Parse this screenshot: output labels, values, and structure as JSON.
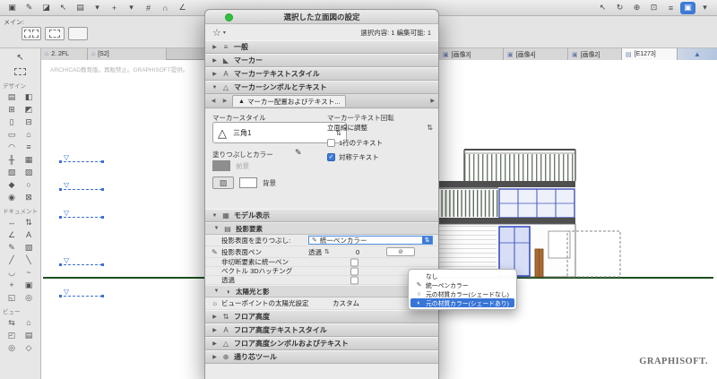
{
  "window": {
    "dialog_title": "選択した立面図の設定",
    "selection_info": "選択内容: 1 編集可能: 1",
    "main_label": "メイン:",
    "watermark": "ARCHICAD教育版。再販禁止。GRAPHISOFT提供。",
    "logo_text": "GRAPHISOFT."
  },
  "colors": {
    "accent": "#3f7ad6",
    "menu_highlight": "#3875d7",
    "selection_blue": "#3b6fd6",
    "ground_green": "#1c4f1c",
    "titlebar_green_dot": "#2ec13e"
  },
  "icons": {
    "select_arrow": "↖",
    "star": "☆",
    "caret_down": "▾",
    "collapsed": "▶",
    "expanded": "▼",
    "left_arrow": "◀",
    "right_arrow": "▶",
    "popup_arrows": "⇅",
    "check": "✓",
    "pen": "✎",
    "null_pen": "⊘",
    "sun": "☼",
    "sun_shadow": "◑",
    "triangle_outline": "△",
    "marker_triangle": "▽",
    "marker_filled": "▲",
    "hatch": "▨",
    "general": "≡",
    "marker": "◣",
    "text_style": "A",
    "symbol_text": "△",
    "model": "▦",
    "projection": "▤",
    "floor": "⇅",
    "grid_tool": "⊕",
    "mountain": "▲"
  },
  "toolbar": {
    "left": [
      {
        "name": "options",
        "glyph": "▣"
      },
      {
        "name": "pencil",
        "glyph": "✎"
      },
      {
        "name": "eraser",
        "glyph": "◪"
      },
      {
        "name": "select-arrow",
        "glyph": "↖"
      },
      {
        "name": "element-default",
        "glyph": "▤"
      },
      {
        "name": "caret-a",
        "glyph": "▾"
      },
      {
        "name": "tracker",
        "glyph": "+"
      },
      {
        "name": "caret-b",
        "glyph": "▾"
      },
      {
        "name": "grid-snap",
        "glyph": "#"
      },
      {
        "name": "snap-magnet",
        "glyph": "∩"
      },
      {
        "name": "guide-line",
        "glyph": "∠"
      }
    ],
    "right": [
      {
        "name": "select",
        "glyph": "↖"
      },
      {
        "name": "orbit",
        "glyph": "↻"
      },
      {
        "name": "zoom",
        "glyph": "⊕"
      },
      {
        "name": "fit-view",
        "glyph": "⊡"
      },
      {
        "name": "layers",
        "glyph": "≡"
      },
      {
        "name": "render",
        "glyph": "▣",
        "active": true
      },
      {
        "name": "more",
        "glyph": "▾"
      }
    ]
  },
  "tabs": [
    {
      "label": "2. 2FL",
      "icon": "⌂"
    },
    {
      "label": "[S2]",
      "icon": "⌂"
    },
    {
      "label": "[画像3]",
      "icon": "▣"
    },
    {
      "label": "[画像4]",
      "icon": "▣"
    },
    {
      "label": "[画像2]",
      "icon": "▣"
    },
    {
      "label": "[E1273]",
      "icon": "▤"
    }
  ],
  "sidebar": {
    "design_label": "デザイン",
    "document_label": "ドキュメント",
    "view_label": "ビュー",
    "design_tools": [
      {
        "name": "wall",
        "glyph": "▤"
      },
      {
        "name": "door",
        "glyph": "◧"
      },
      {
        "name": "window",
        "glyph": "⊞"
      },
      {
        "name": "skylight",
        "glyph": "◩"
      },
      {
        "name": "column",
        "glyph": "▯"
      },
      {
        "name": "beam",
        "glyph": "⊟"
      },
      {
        "name": "slab",
        "glyph": "▭"
      },
      {
        "name": "roof",
        "glyph": "⌂"
      },
      {
        "name": "shell",
        "glyph": "◠"
      },
      {
        "name": "stair",
        "glyph": "≡"
      },
      {
        "name": "railing",
        "glyph": "╫"
      },
      {
        "name": "curtain-wall",
        "glyph": "▦"
      },
      {
        "name": "zone",
        "glyph": "▧"
      },
      {
        "name": "mesh",
        "glyph": "▨"
      },
      {
        "name": "morph",
        "glyph": "◆"
      },
      {
        "name": "object",
        "glyph": "○"
      },
      {
        "name": "lamp",
        "glyph": "◉"
      },
      {
        "name": "opening",
        "glyph": "⊠"
      }
    ],
    "document_tools": [
      {
        "name": "dimension",
        "glyph": "↔"
      },
      {
        "name": "level-dimension",
        "glyph": "⇅"
      },
      {
        "name": "angle-dimension",
        "glyph": "∠"
      },
      {
        "name": "text",
        "glyph": "A"
      },
      {
        "name": "label",
        "glyph": "✎"
      },
      {
        "name": "fill",
        "glyph": "▧"
      },
      {
        "name": "line",
        "glyph": "╱"
      },
      {
        "name": "polyline",
        "glyph": "╲"
      },
      {
        "name": "arc",
        "glyph": "◡"
      },
      {
        "name": "spline",
        "glyph": "~"
      },
      {
        "name": "hotspot",
        "glyph": "+"
      },
      {
        "name": "figure",
        "glyph": "▣"
      },
      {
        "name": "drawing",
        "glyph": "◱"
      },
      {
        "name": "camera",
        "glyph": "◎"
      }
    ],
    "view_tools": [
      {
        "name": "section",
        "glyph": "⇆"
      },
      {
        "name": "elevation",
        "glyph": "⌂"
      },
      {
        "name": "interior-elevation",
        "glyph": "◰"
      },
      {
        "name": "worksheet",
        "glyph": "▤"
      },
      {
        "name": "detail",
        "glyph": "◎"
      },
      {
        "name": "3d-document",
        "glyph": "◇"
      }
    ]
  },
  "dialog": {
    "sections": {
      "general": "一般",
      "marker": "マーカー",
      "marker_text_style": "マーカーテキストスタイル",
      "marker_symbol_text": "マーカーシンボルとテキスト",
      "model_display": "モデル表示",
      "floor_height": "フロア高度",
      "floor_text_style": "フロア高度テキストスタイル",
      "floor_symbol_text": "フロア高度シンボルおよびテキスト",
      "grid_tool": "通り芯ツール"
    },
    "marker_panel": {
      "tab_label": "マーカー配置およびテキスト...",
      "style_label": "マーカースタイル",
      "style_value": "三角1",
      "fill_label": "塗りつぶしとカラー",
      "fg_label": "前景",
      "bg_label": "背景",
      "rotation_label": "マーカーテキスト回転",
      "rotation_value": "立面線に調整",
      "cb_single": "1行のテキスト",
      "cb_symmetric": "対称テキスト"
    },
    "model_panel": {
      "projection_header": "投影要素",
      "fill_label": "投影表面を塗りつぶし:",
      "fill_value": "統一ペンカラー",
      "pen_label": "投影表面ペン",
      "pen_value": "透過",
      "pen_number": "0",
      "cb_uncut": "非切断要素に統一ペン",
      "cb_vector": "ベクトル 3Dハッチング",
      "cb_transparent": "透過",
      "sun_header": "太陽光と影",
      "sun_label": "ビューポイントの太陽光設定",
      "sun_value": "カスタム"
    }
  },
  "menu": {
    "items": [
      {
        "label": "なし",
        "icon": ""
      },
      {
        "label": "統一ペンカラー",
        "icon": "✎"
      },
      {
        "label": "元の材質カラー(シェードなし)",
        "icon": "○"
      },
      {
        "label": "元の材質カラー(シェードあり)",
        "icon": "◐"
      }
    ]
  }
}
